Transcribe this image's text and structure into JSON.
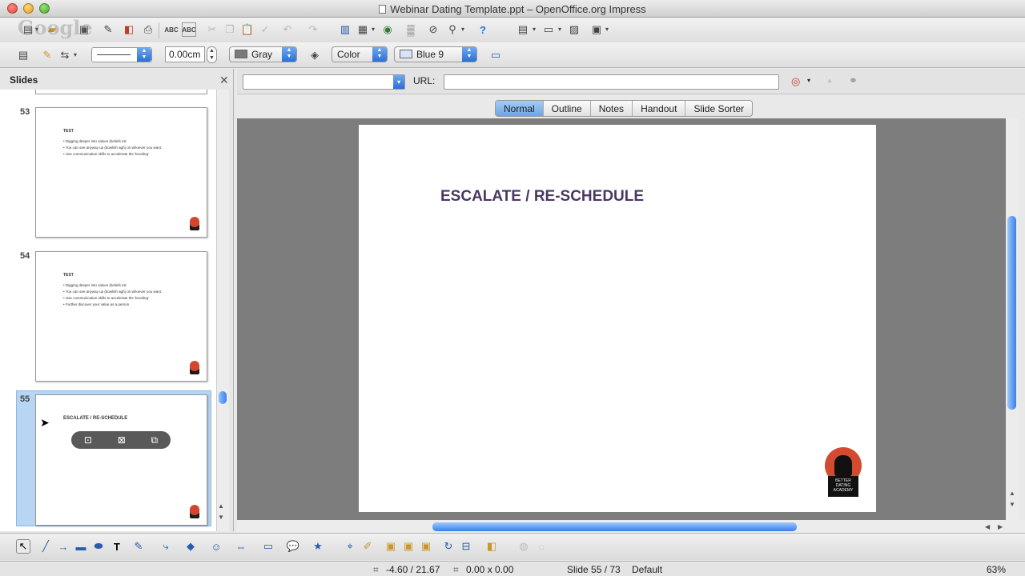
{
  "window": {
    "title": "Webinar Dating Template.ppt – OpenOffice.org Impress"
  },
  "watermark": "Google",
  "formatting": {
    "line_width": "0.00cm",
    "line_color": "Gray",
    "area_style": "Color",
    "area_fill": "Blue 9",
    "colors": {
      "gray": "#7a7a7a",
      "blue9": "#d6e4f5"
    }
  },
  "slides_pane": {
    "title": "Slides",
    "slides": [
      {
        "number": "53",
        "title": "TEST",
        "bullets": [
          "Digging deeper into values (beliefs etc",
          "You can see anyway up (bowlish agh) on whoever you want.",
          "Use communication skills to accelerate the 'bonding'"
        ]
      },
      {
        "number": "54",
        "title": "TEST",
        "bullets": [
          "Digging deeper into values (beliefs etc",
          "You can see anyway up (bowlish agh) on whoever you want.",
          "Use communication skills to accelerate the 'bonding'",
          "Further discover your value as a person"
        ]
      },
      {
        "number": "55",
        "title": "ESCALATE / RE-SCHEDULE",
        "bullets": []
      }
    ]
  },
  "hyperlink_bar": {
    "url_label": "URL:",
    "url_value": ""
  },
  "view_tabs": [
    "Normal",
    "Outline",
    "Notes",
    "Handout",
    "Slide Sorter"
  ],
  "current_slide": {
    "title": "ESCALATE / RE-SCHEDULE",
    "logo_text": "BETTER DATING ACADEMY",
    "title_color": "#4b3663"
  },
  "status": {
    "position": "-4.60 / 21.67",
    "size": "0.00 x 0.00",
    "slide": "Slide 55 / 73",
    "layout": "Default",
    "zoom": "63%"
  }
}
